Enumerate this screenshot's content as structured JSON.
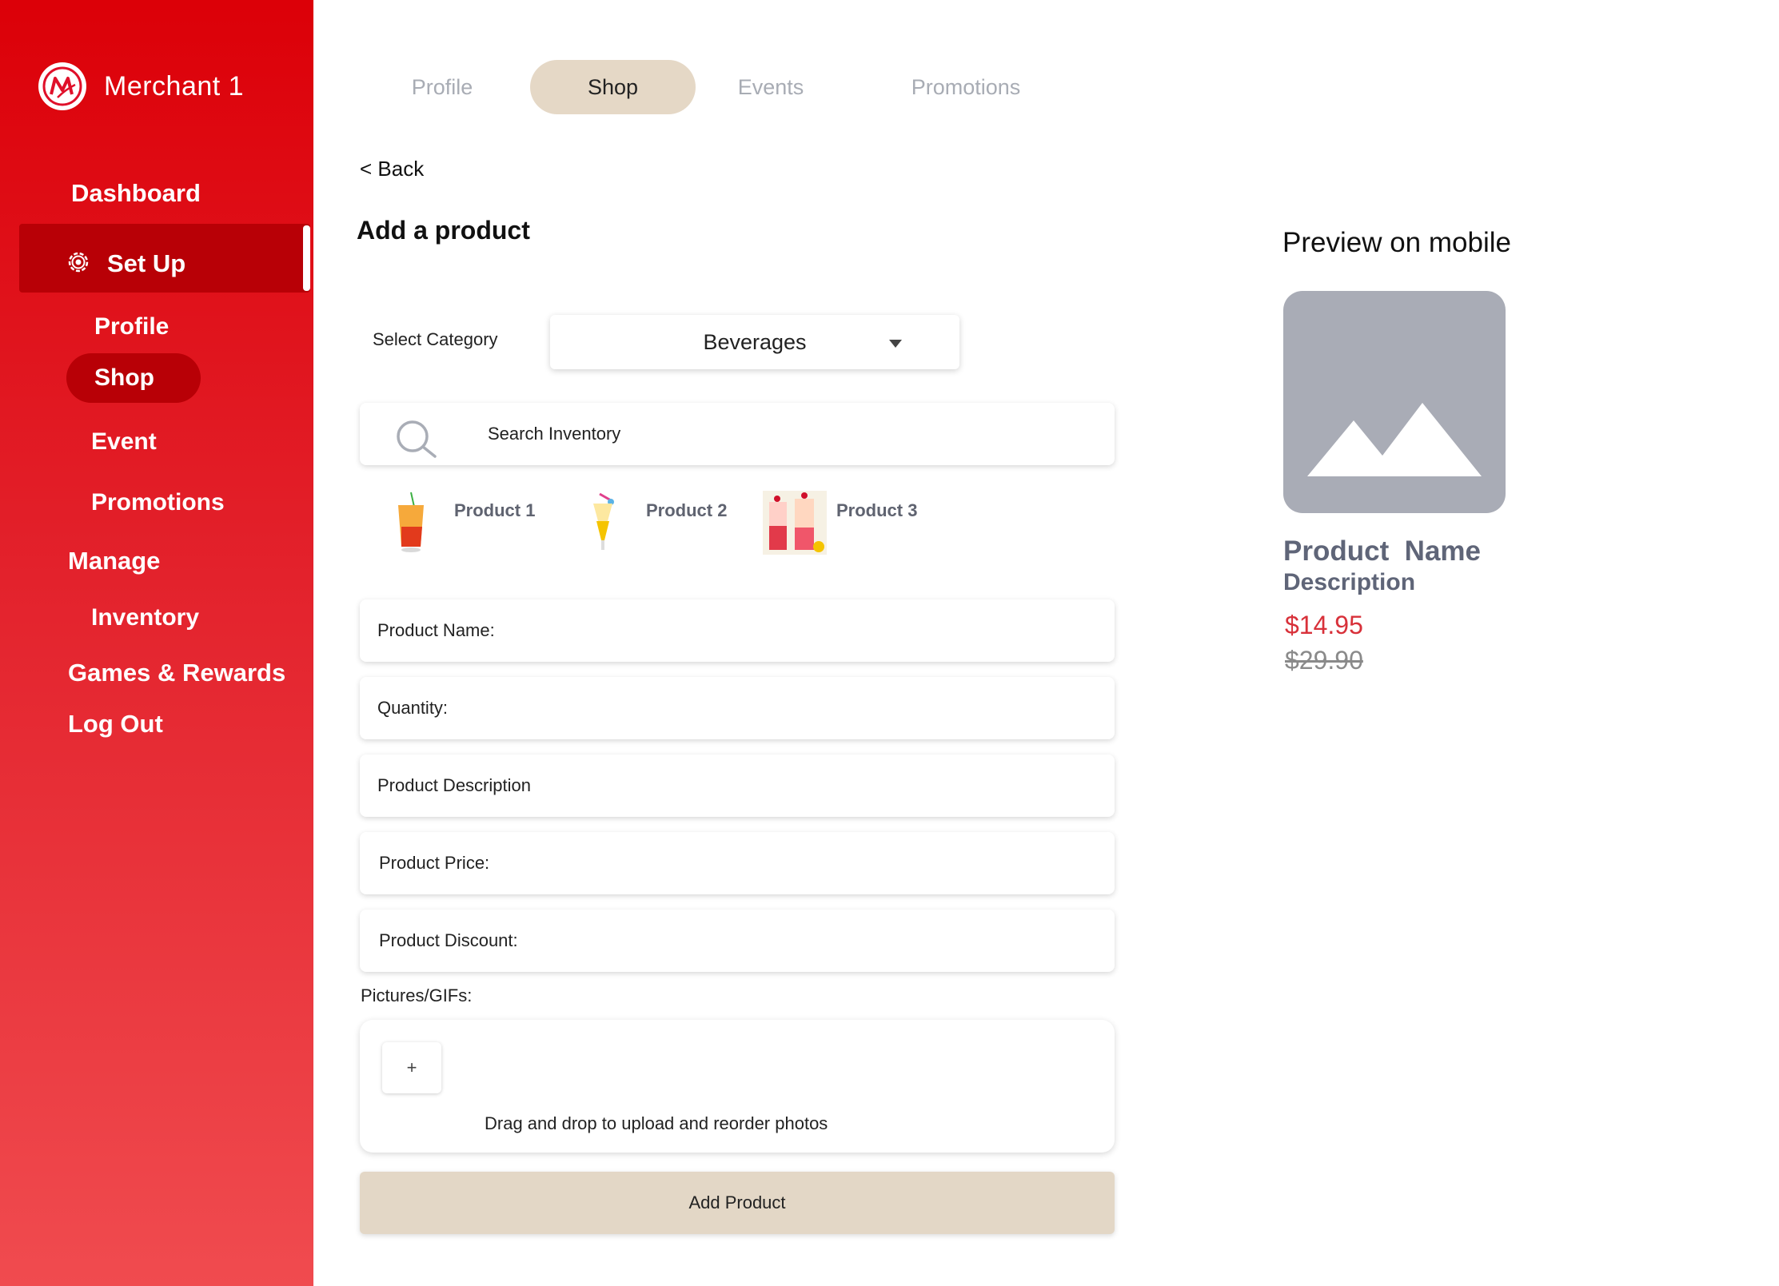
{
  "sidebar": {
    "brand_name": "Merchant 1",
    "logo_icon": "merchant-m-logo",
    "items": {
      "dashboard": "Dashboard",
      "setup": "Set Up",
      "profile": "Profile",
      "shop": "Shop",
      "event": "Event",
      "promotions": "Promotions",
      "manage": "Manage",
      "inventory": "Inventory",
      "games_rewards": "Games & Rewards",
      "logout": "Log Out"
    },
    "setup_icon": "gear-icon",
    "colors": {
      "gradient_top": "#dc0008",
      "gradient_bottom": "#f04b4f",
      "active": "#b80006"
    }
  },
  "tabs": [
    {
      "label": "Profile",
      "active": false
    },
    {
      "label": "Shop",
      "active": true
    },
    {
      "label": "Events",
      "active": false
    },
    {
      "label": "Promotions",
      "active": false
    }
  ],
  "main": {
    "back_label": "< Back",
    "title": "Add a product",
    "category_label": "Select Category",
    "category_value": "Beverages",
    "search_placeholder": "Search Inventory",
    "products": [
      "Product 1",
      "Product 2",
      "Product 3"
    ],
    "fields": {
      "name": "Product Name:",
      "quantity": "Quantity:",
      "description": "Product Description",
      "price": "Product Price:",
      "discount": "Product Discount:"
    },
    "pictures_label": "Pictures/GIFs:",
    "upload_plus": "+",
    "upload_hint": "Drag and drop to upload and reorder photos",
    "add_button": "Add Product",
    "accent_color": "#e5d8c6"
  },
  "preview": {
    "title": "Preview on mobile",
    "image_icon": "image-placeholder-icon",
    "product_name": "Product  Name",
    "description": "Description",
    "price": "$14.95",
    "old_price": "$29.90",
    "price_color": "#d8313a"
  }
}
